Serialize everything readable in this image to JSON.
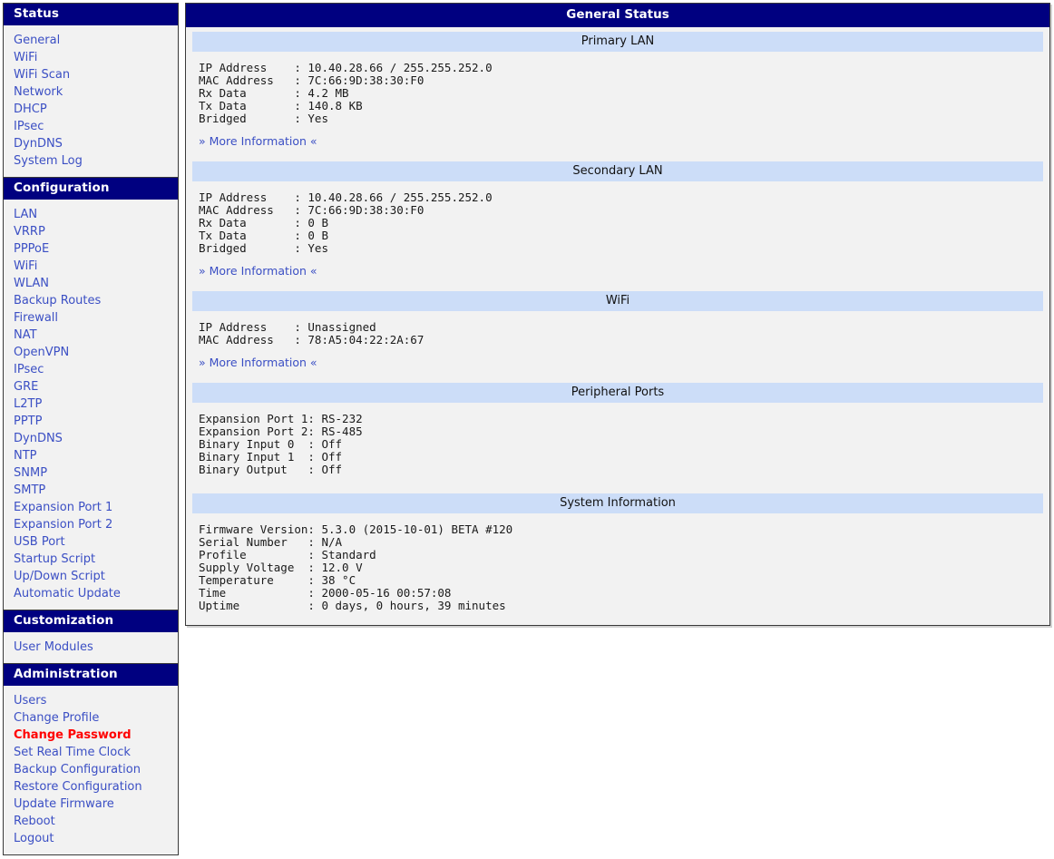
{
  "sidebar": {
    "sections": [
      {
        "title": "Status",
        "items": [
          {
            "label": "General",
            "active": false
          },
          {
            "label": "WiFi",
            "active": false
          },
          {
            "label": "WiFi Scan",
            "active": false
          },
          {
            "label": "Network",
            "active": false
          },
          {
            "label": "DHCP",
            "active": false
          },
          {
            "label": "IPsec",
            "active": false
          },
          {
            "label": "DynDNS",
            "active": false
          },
          {
            "label": "System Log",
            "active": false
          }
        ]
      },
      {
        "title": "Configuration",
        "items": [
          {
            "label": "LAN",
            "active": false
          },
          {
            "label": "VRRP",
            "active": false
          },
          {
            "label": "PPPoE",
            "active": false
          },
          {
            "label": "WiFi",
            "active": false
          },
          {
            "label": "WLAN",
            "active": false
          },
          {
            "label": "Backup Routes",
            "active": false
          },
          {
            "label": "Firewall",
            "active": false
          },
          {
            "label": "NAT",
            "active": false
          },
          {
            "label": "OpenVPN",
            "active": false
          },
          {
            "label": "IPsec",
            "active": false
          },
          {
            "label": "GRE",
            "active": false
          },
          {
            "label": "L2TP",
            "active": false
          },
          {
            "label": "PPTP",
            "active": false
          },
          {
            "label": "DynDNS",
            "active": false
          },
          {
            "label": "NTP",
            "active": false
          },
          {
            "label": "SNMP",
            "active": false
          },
          {
            "label": "SMTP",
            "active": false
          },
          {
            "label": "Expansion Port 1",
            "active": false
          },
          {
            "label": "Expansion Port 2",
            "active": false
          },
          {
            "label": "USB Port",
            "active": false
          },
          {
            "label": "Startup Script",
            "active": false
          },
          {
            "label": "Up/Down Script",
            "active": false
          },
          {
            "label": "Automatic Update",
            "active": false
          }
        ]
      },
      {
        "title": "Customization",
        "items": [
          {
            "label": "User Modules",
            "active": false
          }
        ]
      },
      {
        "title": "Administration",
        "items": [
          {
            "label": "Users",
            "active": false
          },
          {
            "label": "Change Profile",
            "active": false
          },
          {
            "label": "Change Password",
            "active": true
          },
          {
            "label": "Set Real Time Clock",
            "active": false
          },
          {
            "label": "Backup Configuration",
            "active": false
          },
          {
            "label": "Restore Configuration",
            "active": false
          },
          {
            "label": "Update Firmware",
            "active": false
          },
          {
            "label": "Reboot",
            "active": false
          },
          {
            "label": "Logout",
            "active": false
          }
        ]
      }
    ]
  },
  "main": {
    "title": "General Status",
    "more_information_label": "» More Information «",
    "sections": [
      {
        "title": "Primary LAN",
        "label_width": 14,
        "rows": [
          {
            "label": "IP Address",
            "value": "10.40.28.66 / 255.255.252.0"
          },
          {
            "label": "MAC Address",
            "value": "7C:66:9D:38:30:F0"
          },
          {
            "label": "Rx Data",
            "value": "4.2 MB"
          },
          {
            "label": "Tx Data",
            "value": "140.8 KB"
          },
          {
            "label": "Bridged",
            "value": "Yes"
          }
        ],
        "has_more_link": true
      },
      {
        "title": "Secondary LAN",
        "label_width": 14,
        "rows": [
          {
            "label": "IP Address",
            "value": "10.40.28.66 / 255.255.252.0"
          },
          {
            "label": "MAC Address",
            "value": "7C:66:9D:38:30:F0"
          },
          {
            "label": "Rx Data",
            "value": "0 B"
          },
          {
            "label": "Tx Data",
            "value": "0 B"
          },
          {
            "label": "Bridged",
            "value": "Yes"
          }
        ],
        "has_more_link": true
      },
      {
        "title": "WiFi",
        "label_width": 14,
        "rows": [
          {
            "label": "IP Address",
            "value": "Unassigned"
          },
          {
            "label": "MAC Address",
            "value": "78:A5:04:22:2A:67"
          }
        ],
        "has_more_link": true
      },
      {
        "title": "Peripheral Ports",
        "label_width": 16,
        "rows": [
          {
            "label": "Expansion Port 1",
            "value": "RS-232"
          },
          {
            "label": "Expansion Port 2",
            "value": "RS-485"
          },
          {
            "label": "Binary Input 0",
            "value": "Off"
          },
          {
            "label": "Binary Input 1",
            "value": "Off"
          },
          {
            "label": "Binary Output",
            "value": "Off"
          }
        ],
        "has_more_link": false
      },
      {
        "title": "System Information",
        "label_width": 16,
        "rows": [
          {
            "label": "Firmware Version",
            "value": "5.3.0 (2015-10-01) BETA #120"
          },
          {
            "label": "Serial Number",
            "value": "N/A"
          },
          {
            "label": "Profile",
            "value": "Standard"
          },
          {
            "label": "Supply Voltage",
            "value": "12.0 V"
          },
          {
            "label": "Temperature",
            "value": "38 °C"
          },
          {
            "label": "Time",
            "value": "2000-05-16 00:57:08"
          },
          {
            "label": "Uptime",
            "value": "0 days, 0 hours, 39 minutes"
          }
        ],
        "has_more_link": false
      }
    ]
  },
  "colors": {
    "header_navy": "#000080",
    "section_blue": "#ccddf8",
    "link_blue": "#3b4fc4",
    "active_red": "#ff0000",
    "panel_bg": "#f2f2f2",
    "border": "#3a3a3a"
  }
}
